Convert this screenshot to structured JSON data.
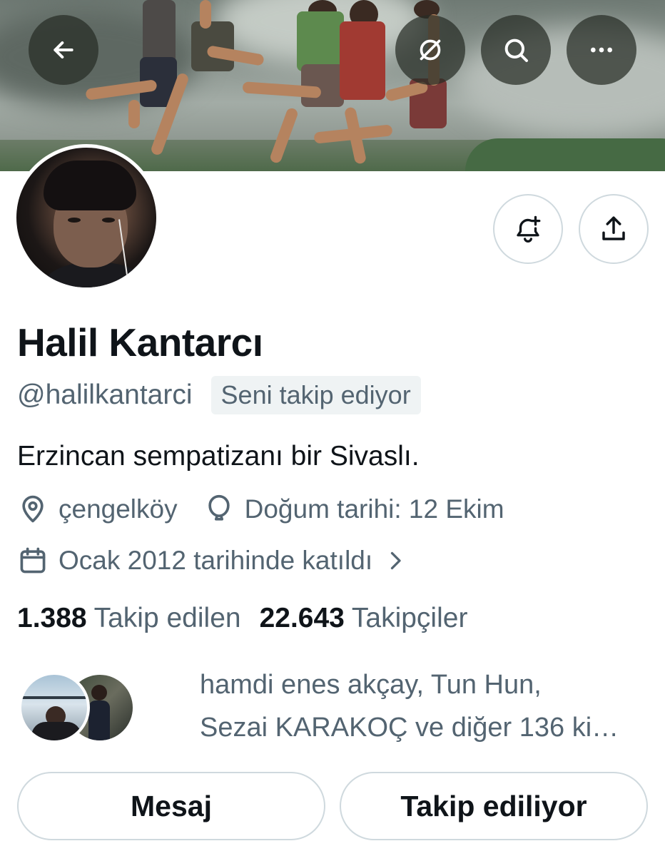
{
  "header": {
    "back_icon": "arrow-left-icon",
    "actions": [
      {
        "name": "grok-icon"
      },
      {
        "name": "search-icon"
      },
      {
        "name": "more-icon"
      }
    ]
  },
  "profile": {
    "display_name": "Halil Kantarcı",
    "handle": "@halilkantarci",
    "follows_you_badge": "Seni takip ediyor",
    "bio": "Erzincan sempatizanı bir Sivaslı.",
    "location": "çengelköy",
    "birthday": "Doğum tarihi: 12 Ekim",
    "joined": "Ocak 2012 tarihinde katıldı",
    "following_count": "1.388",
    "following_label": "Takip edilen",
    "followers_count": "22.643",
    "followers_label": "Takipçiler",
    "followed_by_line1": "hamdi enes akçay, Tun Hun,",
    "followed_by_line2": "Sezai KARAKOÇ ve diğer 136 ki…"
  },
  "buttons": {
    "message": "Mesaj",
    "following": "Takip ediliyor"
  },
  "colors": {
    "text_primary": "#0f1419",
    "text_secondary": "#536471",
    "border": "#cfd9de",
    "badge_bg": "#eff3f4"
  }
}
